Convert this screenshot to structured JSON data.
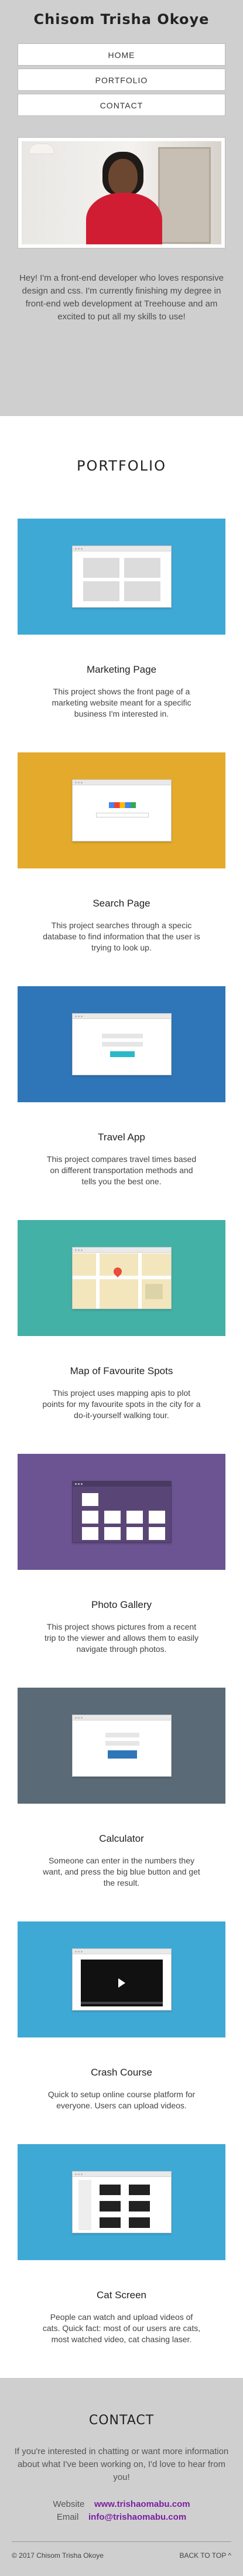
{
  "header": {
    "title": "Chisom Trisha Okoye",
    "nav": [
      "HOME",
      "PORTFOLIO",
      "CONTACT"
    ],
    "intro": "Hey! I'm a front-end developer who loves responsive design and css. I'm currently finishing my degree in front-end web development at Treehouse and am excited to put all my skills to use!"
  },
  "portfolio": {
    "heading": "PORTFOLIO",
    "projects": [
      {
        "title": "Marketing Page",
        "description": "This project shows the front page of a marketing website meant for a specific business I'm interested in.",
        "color": "#3fa9d6"
      },
      {
        "title": "Search Page",
        "description": "This project searches through a specic database to find information that the user is trying to look up.",
        "color": "#e3aa2b"
      },
      {
        "title": "Travel App",
        "description": "This project compares travel times based on different transportation methods and tells you the best one.",
        "color": "#2e76b8"
      },
      {
        "title": "Map of Favourite Spots",
        "description": "This project uses mapping apis to plot points for my favourite spots in the city for a do-it-yourself walking tour.",
        "color": "#43b1a5"
      },
      {
        "title": "Photo Gallery",
        "description": "This project shows pictures from a recent trip to the viewer and allows them to easily navigate through photos.",
        "color": "#6b5491"
      },
      {
        "title": "Calculator",
        "description": "Someone can enter in the numbers they want, and press the big blue button and get the result.",
        "color": "#5a6a77"
      },
      {
        "title": "Crash Course",
        "description": "Quick to setup online course platform for everyone. Users can upload videos.",
        "color": "#3fa9d6"
      },
      {
        "title": "Cat Screen",
        "description": "People can watch and upload videos of cats. Quick fact: most of our users are cats, most watched video, cat chasing laser.",
        "color": "#3fa9d6"
      }
    ]
  },
  "contact": {
    "heading": "CONTACT",
    "message": "If you're interested in chatting or want more information about what I've been working on, I'd love to hear from you!",
    "website_label": "Website",
    "website": "www.trishaomabu.com",
    "email_label": "Email",
    "email": "info@trishaomabu.com",
    "copyright": "© 2017 Chisom Trisha Okoye",
    "back_to_top": "BACK TO TOP ^"
  }
}
